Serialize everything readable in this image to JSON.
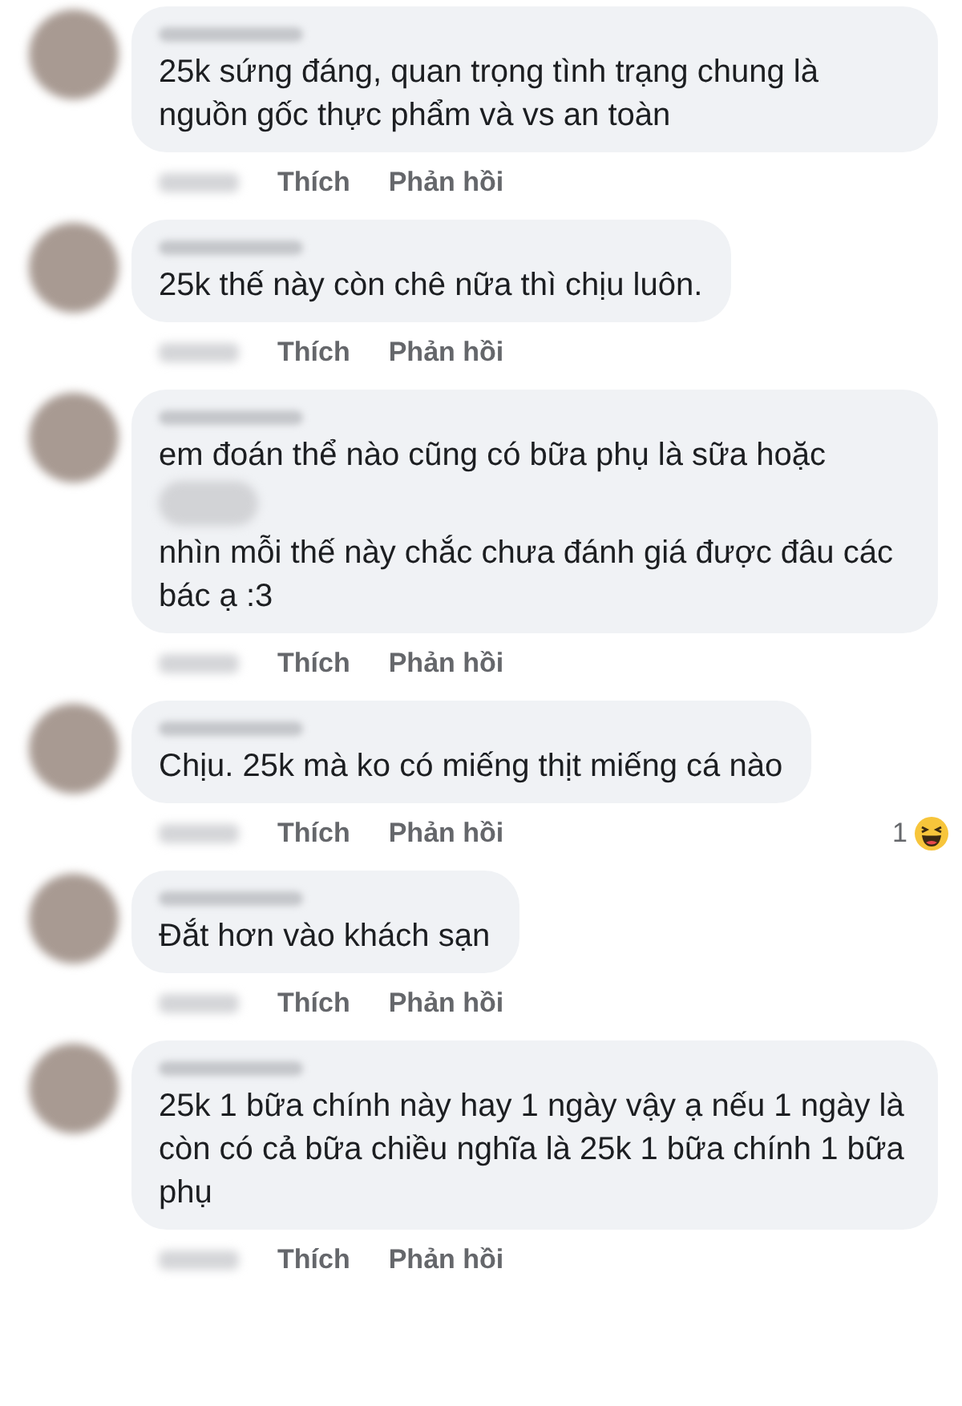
{
  "comments": [
    {
      "body": [
        {
          "kind": "text",
          "text": "25k sứng đáng, quan trọng tình trạng chung là nguồn gốc thực phẩm và vs an toàn"
        }
      ],
      "actions": [
        "Thích",
        "Phản hồi"
      ]
    },
    {
      "body": [
        {
          "kind": "text",
          "text": "25k thế này còn chê nữa thì chịu luôn."
        }
      ],
      "actions": [
        "Thích",
        "Phản hồi"
      ]
    },
    {
      "body": [
        {
          "kind": "text",
          "text": "em đoán thể nào cũng có bữa phụ là sữa hoặc"
        },
        {
          "kind": "redacted"
        },
        {
          "kind": "text",
          "text": "nhìn mỗi thế này chắc chưa đánh giá được đâu các bác ạ :3"
        }
      ],
      "actions": [
        "Thích",
        "Phản hồi"
      ]
    },
    {
      "body": [
        {
          "kind": "text",
          "text": "Chịu. 25k mà ko có miếng thịt miếng cá nào"
        }
      ],
      "actions": [
        "Thích",
        "Phản hồi"
      ],
      "reaction_count": "1"
    },
    {
      "body": [
        {
          "kind": "text",
          "text": "Đắt hơn vào khách sạn"
        }
      ],
      "actions": [
        "Thích",
        "Phản hồi"
      ]
    },
    {
      "body": [
        {
          "kind": "text",
          "text": "25k 1 bữa chính này hay 1 ngày vậy ạ nếu 1 ngày là còn có cả bữa chiều nghĩa là 25k 1 bữa chính 1 bữa phụ"
        }
      ],
      "actions": [
        "Thích",
        "Phản hồi"
      ]
    }
  ]
}
